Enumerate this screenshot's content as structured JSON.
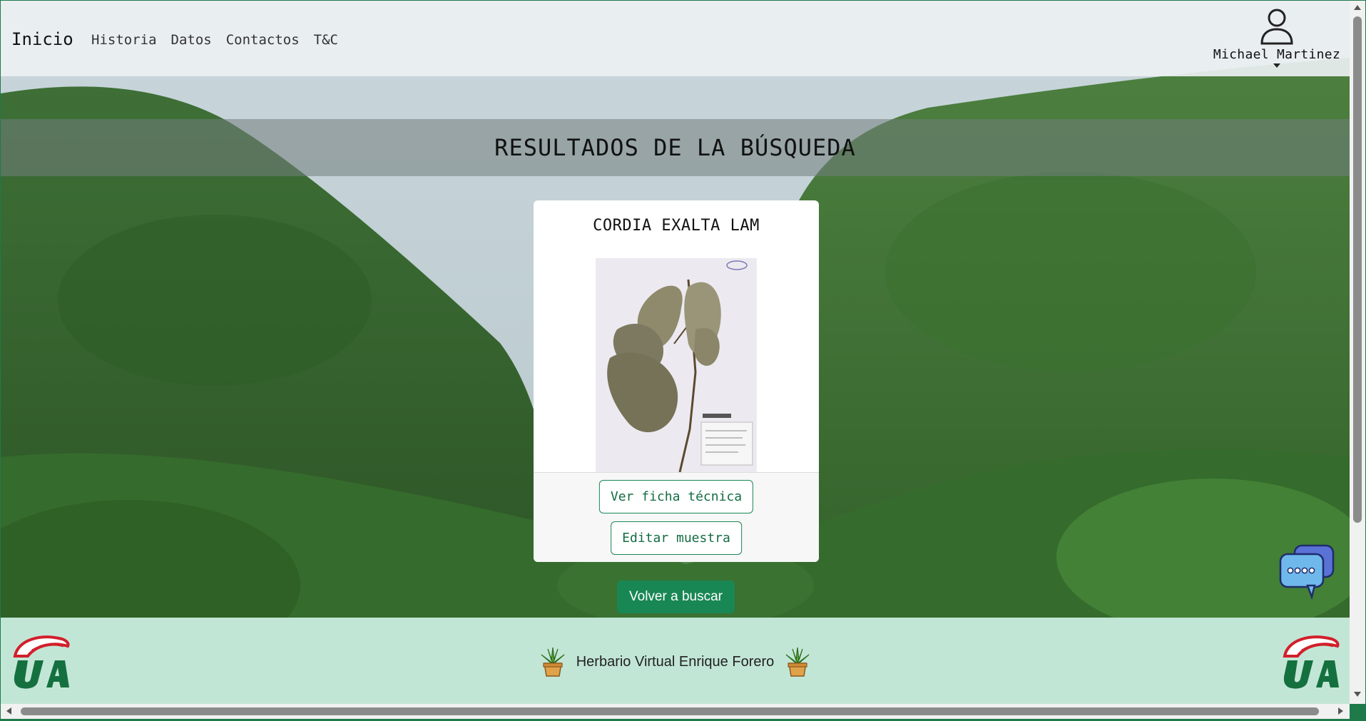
{
  "navbar": {
    "brand": "Inicio",
    "links": [
      "Historia",
      "Datos",
      "Contactos",
      "T&C"
    ],
    "user_name": "Michael Martinez",
    "user_icon": "person-icon"
  },
  "banner": {
    "title": "RESULTADOS DE LA BÚSQUEDA"
  },
  "result_card": {
    "title": "CORDIA EXALTA LAM",
    "image": "herbarium-specimen-image",
    "view_button": "Ver ficha técnica",
    "edit_button": "Editar muestra"
  },
  "back_button": "Volver a buscar",
  "chat_widget": {
    "icon": "chat-bubbles-icon"
  },
  "footer": {
    "text": "Herbario Virtual Enrique Forero",
    "left_icon": "potted-plant-icon",
    "right_icon": "potted-plant-icon",
    "logo": "university-logo"
  },
  "colors": {
    "primary_green": "#198754",
    "footer_bg": "#c2e6d6",
    "frame": "#1f7a4a"
  }
}
